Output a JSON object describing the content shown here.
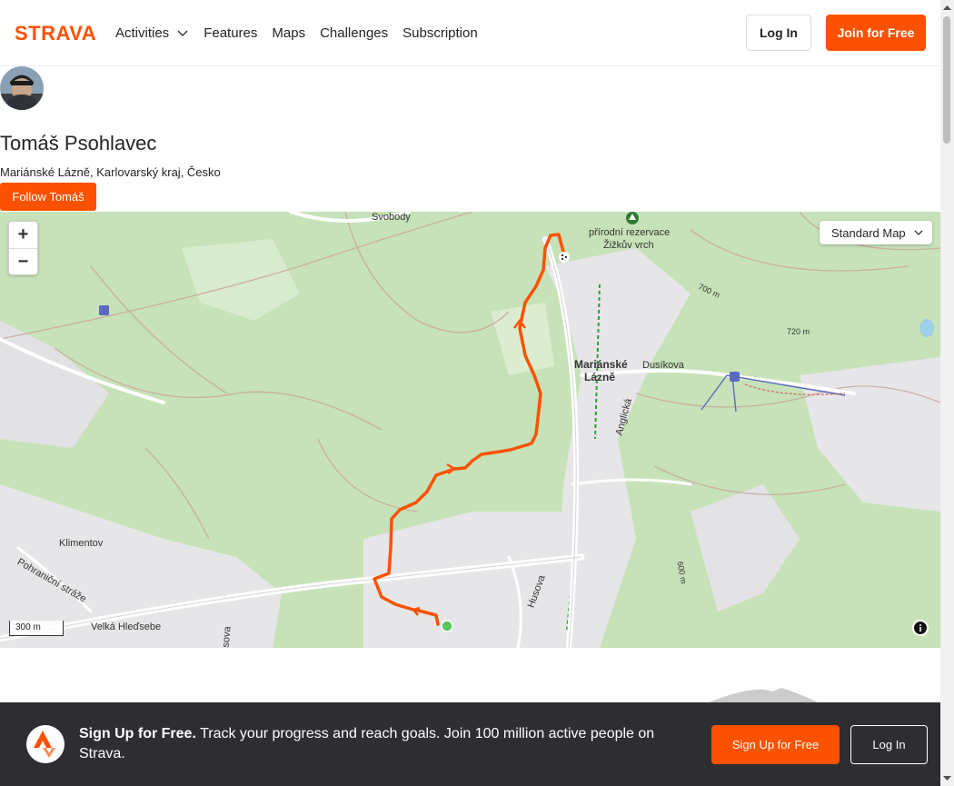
{
  "brand": {
    "logo_text": "STRAVA",
    "accent": "#fc5200"
  },
  "nav": {
    "items": [
      {
        "label": "Activities",
        "has_dropdown": true
      },
      {
        "label": "Features"
      },
      {
        "label": "Maps"
      },
      {
        "label": "Challenges"
      },
      {
        "label": "Subscription"
      }
    ],
    "login_label": "Log In",
    "join_label": "Join for Free"
  },
  "athlete": {
    "name": "Tomáš Psohlavec",
    "location": "Mariánské Lázně, Karlovarský kraj, Česko",
    "follow_label": "Follow Tomáš"
  },
  "map": {
    "style_select": "Standard Map",
    "scale_label": "300 m",
    "zoom_in": "+",
    "zoom_out": "−",
    "labels": {
      "reserve_1": "přírodní rezervace",
      "reserve_2": "Žižkův vrch",
      "town_1": "Mariánské",
      "town_2": "Lázně",
      "duskova": "Dusíkova",
      "anglicka": "Anglická",
      "klimentov": "Klimentov",
      "pohranicni": "Pohraniční stráže",
      "velka": "Velká Hleďsebe",
      "husova": "Husova",
      "svobody": "Svobody",
      "m700": "700 m",
      "m720": "720 m",
      "m600": "600 m",
      "sova": "sova"
    },
    "route_color": "#fc5200",
    "start_color": "#5cc45c"
  },
  "banner": {
    "headline": "Sign Up for Free.",
    "body": "Track your progress and reach goals. Join 100 million active people on Strava.",
    "signup_label": "Sign Up for Free",
    "login_label": "Log In"
  }
}
